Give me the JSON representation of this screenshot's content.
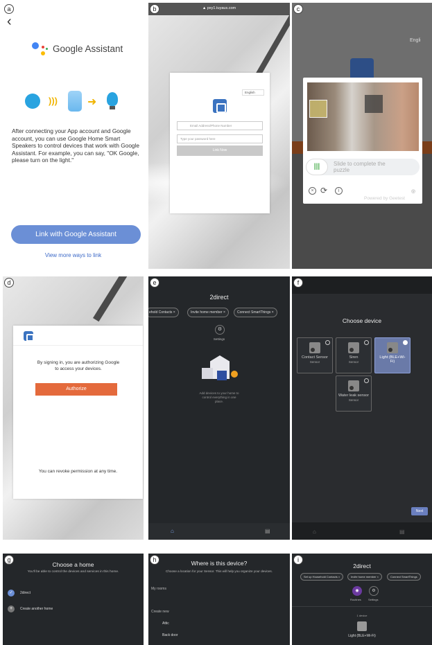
{
  "labels": {
    "a": "a",
    "b": "b",
    "c": "c",
    "d": "d",
    "e": "e",
    "f": "f",
    "g": "g",
    "h": "h",
    "i": "i"
  },
  "a": {
    "back_icon": "‹",
    "brand": "Google Assistant",
    "description": "After connecting your App account and Google account, you can use Google Home Smart Speakers to control devices that work with Google Assistant.  For example, you can say, \"OK Google, please turn on  the light.\"",
    "link_button": "Link with Google Assistant",
    "more_link": "View more ways to link",
    "colors": {
      "blue": "#4285f4",
      "red": "#ea4335",
      "yellow": "#fbbc05",
      "green": "#34a853",
      "button": "#6b8fd6"
    }
  },
  "b": {
    "url": "▲ pxy1.tuyaus.com",
    "language": "English",
    "email_placeholder": "Email Address/Phone Number",
    "password_placeholder": "Type your password here",
    "login_label": "Link Now"
  },
  "c": {
    "language": "Engli",
    "slider_text": "Slide to complete the puzzle",
    "powered": "Powered by Geetest"
  },
  "d": {
    "auth_text": "By signing in, you are authorizing Google to access your devices.",
    "authorize_button": "Authorize",
    "revoke_text": "You can revoke permission at any time."
  },
  "e": {
    "title": "2direct",
    "chips": [
      "ehold Contacts",
      "Invite home member",
      "Connect SmartThings"
    ],
    "settings": "Settings",
    "empty_text": "Add devices to your home to control everything in one place."
  },
  "f": {
    "title": "Choose device",
    "tiles": [
      {
        "name": "Contact Sensor",
        "type": "Sensor"
      },
      {
        "name": "Siren",
        "type": "Sensor"
      },
      {
        "name": "Light (BLE+Wi-Fi)",
        "type": ""
      },
      {
        "name": "Water leak sensor",
        "type": "Sensor"
      }
    ],
    "next": "Next"
  },
  "g": {
    "title": "Choose a home",
    "subtitle": "You'll be able to control the devices and services in this home.",
    "home": "2direct",
    "create": "Create another home"
  },
  "h": {
    "title": "Where is this device?",
    "subtitle": "Choose a location for your Sensor. This will help you organize your devices.",
    "my_rooms": "My rooms",
    "create_new": "Create new",
    "rooms": [
      "Attic",
      "Back door"
    ]
  },
  "i": {
    "title": "2direct",
    "chips": [
      "Set up Household Contacts",
      "Invite home member",
      "Connect SmartThings"
    ],
    "routines": "Routines",
    "settings": "Settings",
    "device_count": "1 device",
    "device_name": "Light (BLE+Wi-Fi)"
  }
}
